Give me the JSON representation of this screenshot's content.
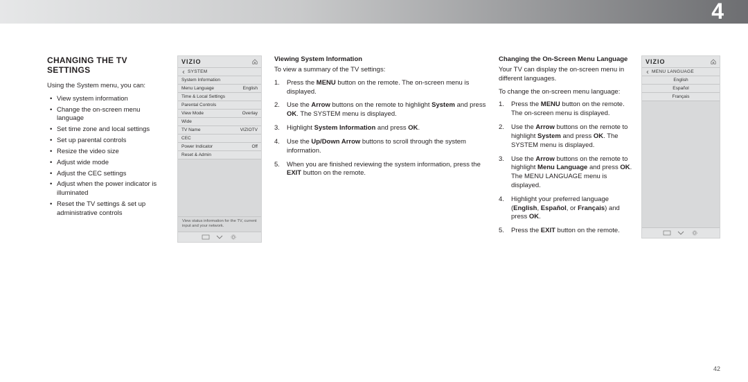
{
  "chapter_number": "4",
  "page_number": "42",
  "section_title": "CHANGING THE TV SETTINGS",
  "col1": {
    "intro": "Using the System menu, you can:",
    "bullets": [
      "View system information",
      "Change the on-screen menu language",
      "Set time zone and local settings",
      "Set up parental controls",
      "Resize the video size",
      "Adjust wide mode",
      "Adjust the CEC settings",
      "Adjust when the power indicator is illuminated",
      "Reset the TV settings & set up administrative controls"
    ]
  },
  "vizio_system": {
    "logo": "VIZIO",
    "menu_title": "SYSTEM",
    "rows": [
      {
        "label": "System Information",
        "value": ""
      },
      {
        "label": "Menu Language",
        "value": "English"
      },
      {
        "label": "Time & Local Settings",
        "value": ""
      },
      {
        "label": "Parental Controls",
        "value": ""
      },
      {
        "label": "View Mode",
        "value": "Overlay"
      },
      {
        "label": "Wide",
        "value": ""
      },
      {
        "label": "TV Name",
        "value": "VIZIOTV"
      },
      {
        "label": "CEC",
        "value": ""
      },
      {
        "label": "Power Indicator",
        "value": "Off"
      },
      {
        "label": "Reset & Admin",
        "value": ""
      }
    ],
    "hint": "View status information for the TV, current input and your network."
  },
  "col2": {
    "heading": "Viewing System Information",
    "intro": "To view a summary of the TV settings:",
    "steps": [
      "Press the <b>MENU</b> button on the remote. The on-screen menu is displayed.",
      "Use the <b>Arrow</b> buttons on the remote to highlight <b>System</b> and press <b>OK</b>. The SYSTEM menu is displayed.",
      "Highlight <b>System Information</b> and press <b>OK</b>.",
      "Use the <b>Up/Down Arrow</b> buttons to scroll through the system information.",
      "When you are finished reviewing the system information, press the <b>EXIT</b> button on the remote."
    ]
  },
  "col3": {
    "heading": "Changing the On-Screen Menu Language",
    "intro1": "Your TV can display the on-screen menu in different languages.",
    "intro2": "To change the on-screen menu language:",
    "steps": [
      "Press the <b>MENU</b> button on the remote. The on-screen menu is displayed.",
      "Use the <b>Arrow</b> buttons on the remote to highlight <b>System</b> and press <b>OK</b>. The SYSTEM menu is displayed.",
      "Use the <b>Arrow</b> buttons on the remote to highlight <b>Menu Language</b> and press <b>OK</b>. The MENU LANGUAGE menu is displayed.",
      "Highlight your preferred language (<b>English</b>, <b>Español</b>, or <b>Français</b>) and press <b>OK</b>.",
      "Press the <b>EXIT</b> button on the remote."
    ]
  },
  "vizio_lang": {
    "logo": "VIZIO",
    "menu_title": "MENU LANGUAGE",
    "rows": [
      "English",
      "Español",
      "Français"
    ]
  }
}
